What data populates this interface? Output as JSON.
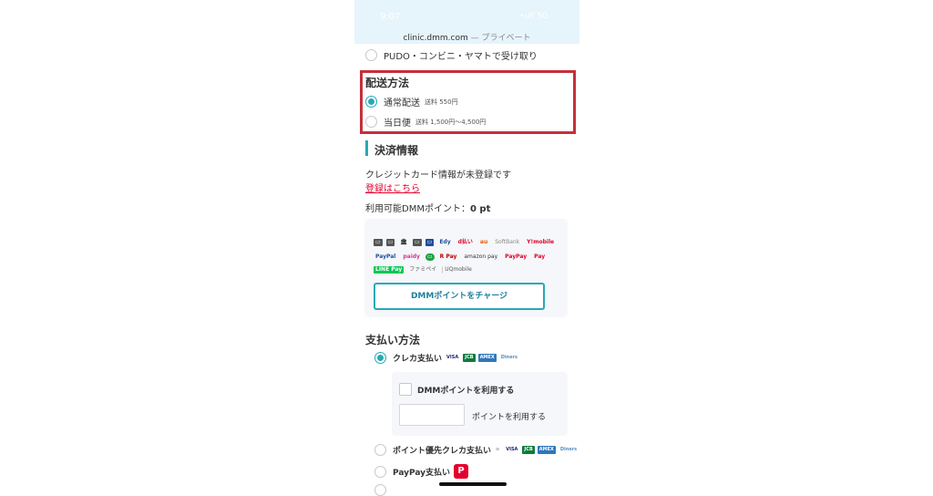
{
  "status": {
    "time": "9:07",
    "signal": "•ull 5G"
  },
  "browser": {
    "domain": "clinic.dmm.com",
    "separator": "—",
    "mode": "プライベート"
  },
  "pickup_option": {
    "label": "PUDO・コンビニ・ヤマトで受け取り"
  },
  "shipping": {
    "title": "配送方法",
    "options": [
      {
        "label": "通常配送",
        "fee": "送料 550円",
        "selected": true
      },
      {
        "label": "当日便",
        "fee": "送料 1,500円〜4,500円",
        "selected": false
      }
    ]
  },
  "payment_info": {
    "title": "決済情報",
    "card_status": "クレジットカード情報が未登録です",
    "register_link": "登録はこちら",
    "points_label": "利用可能DMMポイント：",
    "points_value": "0 pt",
    "logos_row1": [
      "▭",
      "▭",
      "🏛",
      "▭",
      "▭",
      "Edy",
      "d払い",
      "au",
      "SoftBank",
      "Y!mobile"
    ],
    "logos_row2": [
      "PayPal",
      "paidy",
      "▭",
      "R Pay",
      "amazon pay",
      "PayPay",
      "Pay"
    ],
    "logos_row3": [
      "LINE Pay",
      "ファミペイ",
      "UQmobile"
    ],
    "charge_button": "DMMポイントをチャージ"
  },
  "payment_method": {
    "title": "支払い方法",
    "options": [
      {
        "label": "クレカ支払い",
        "selected": true
      },
      {
        "label": "ポイント優先クレカ支払い",
        "selected": false
      },
      {
        "label": "PayPay支払い",
        "selected": false
      }
    ],
    "card_brands": [
      "VISA",
      "JCB",
      "AMEX",
      "Diners"
    ],
    "use_points_label": "DMMポイントを利用する",
    "use_points_suffix": "ポイントを利用する",
    "paypay_icon": "P"
  },
  "colors": {
    "accent": "#27a9b5",
    "highlight": "#c62f3a",
    "link": "#e4002b",
    "status_bg": "#e6f4fb"
  }
}
